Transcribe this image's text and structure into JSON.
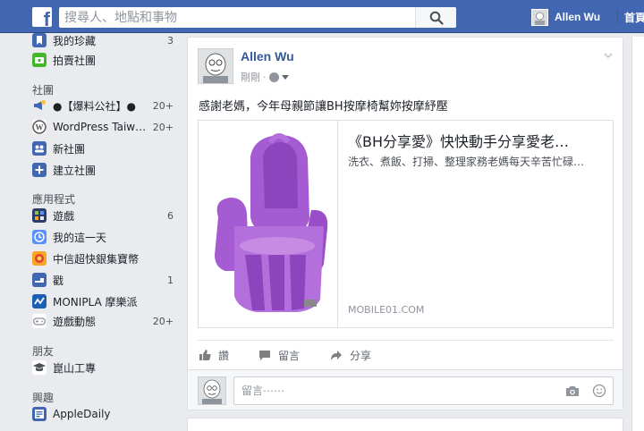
{
  "topbar": {
    "logo_letter": "f",
    "search_placeholder": "搜尋人、地點和事物",
    "user_name": "Allen Wu",
    "home_label": "首頁"
  },
  "sidebar": {
    "top_items": [
      {
        "label": "我的珍藏",
        "count": "3",
        "icon": "bookmark-icon",
        "color": "#4267b2"
      },
      {
        "label": "拍賣社團",
        "count": "",
        "icon": "sale-group-icon",
        "color": "#42b72a"
      }
    ],
    "groups_heading": "社團",
    "group_items": [
      {
        "label": "●【爆料公社】●",
        "count": "20+",
        "icon": "megaphone-icon",
        "color": "#4267b2"
      },
      {
        "label": "WordPress Taiw…",
        "count": "20+",
        "icon": "wordpress-icon",
        "color": "#555555"
      },
      {
        "label": "新社團",
        "count": "",
        "icon": "new-group-icon",
        "color": "#4267b2"
      },
      {
        "label": "建立社團",
        "count": "",
        "icon": "create-group-icon",
        "color": "#4267b2"
      }
    ],
    "apps_heading": "應用程式",
    "app_items": [
      {
        "label": "遊戲",
        "count": "6",
        "icon": "games-icon",
        "color": "#2d3d6b"
      },
      {
        "label": "我的這一天",
        "count": "",
        "icon": "on-this-day-icon",
        "color": "#5890ff"
      },
      {
        "label": "中信超快銀集寶幣",
        "count": "",
        "icon": "ctbc-app-icon",
        "color": "#f5a623"
      },
      {
        "label": "戳",
        "count": "1",
        "icon": "poke-icon",
        "color": "#4267b2"
      },
      {
        "label": "MONIPLA 摩樂派",
        "count": "",
        "icon": "monipla-icon",
        "color": "#1a5fb4"
      },
      {
        "label": "遊戲動態",
        "count": "20+",
        "icon": "game-feed-icon",
        "color": "#8d949e"
      }
    ],
    "friends_heading": "朋友",
    "friend_items": [
      {
        "label": "崑山工專",
        "count": "",
        "icon": "school-icon",
        "color": "#4b4f56"
      }
    ],
    "interests_heading": "興趣",
    "interest_items": [
      {
        "label": "AppleDaily",
        "count": "",
        "icon": "rss-icon",
        "color": "#4267b2"
      }
    ]
  },
  "post": {
    "author": "Allen Wu",
    "time": "剛剛",
    "dot": "·",
    "text": "感謝老媽，今年母親節讓BH按摩椅幫妳按摩紓壓",
    "link": {
      "title": "《BH分享愛》快快動手分享愛老…",
      "description": "洗衣、煮飯、打掃、整理家務老媽每天辛苦忙碌…",
      "domain": "MOBILE01.COM"
    },
    "actions": {
      "like": "讚",
      "comment": "留言",
      "share": "分享"
    },
    "comment_placeholder": "留言⋯⋯"
  },
  "colors": {
    "brand_blue": "#4267b2",
    "link_blue": "#365899",
    "chair_purple": "#9b4fc9"
  }
}
